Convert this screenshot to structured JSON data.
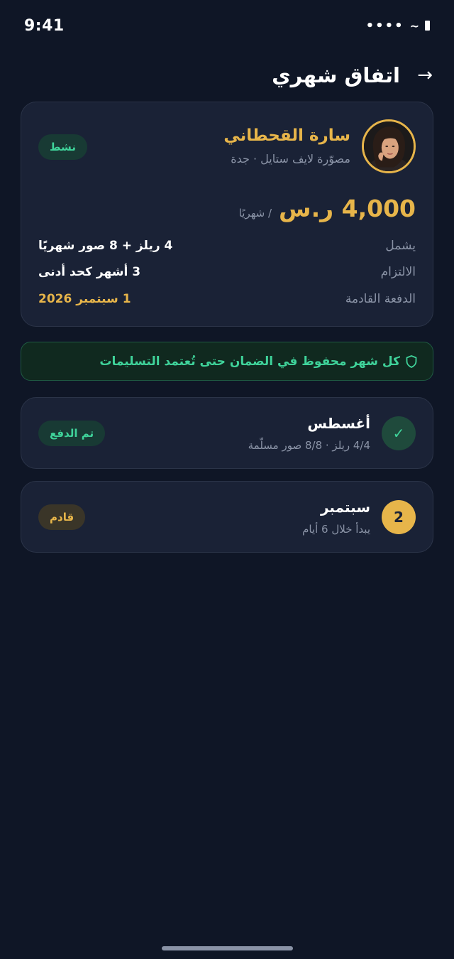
{
  "status_bar": {
    "time": "9:41",
    "signal": "••••",
    "wifi": "~"
  },
  "header": {
    "title": "اتفاق شهري",
    "back_icon": "arrow-right-icon",
    "back_glyph": "→"
  },
  "agreement": {
    "creator_name": "سارة القحطاني",
    "creator_subtitle": "مصوّرة لايف ستايل · جدة",
    "status_badge": "نشط",
    "price": "4,000 ر.س",
    "price_period": "/ شهريًا",
    "details": [
      {
        "label": "يشمل",
        "value": "4 ريلز + 8 صور شهريًا"
      },
      {
        "label": "الالتزام",
        "value": "3 أشهر كحد أدنى"
      },
      {
        "label": "الدفعة القادمة",
        "value": "1 سبتمبر 2026"
      }
    ]
  },
  "escrow": {
    "icon": "shield-icon",
    "text": "كل شهر محفوظ في الضمان حتى تُعتمد التسليمات"
  },
  "months": [
    {
      "name": "أغسطس",
      "subtitle": "4/4 ريلز · 8/8 صور مسلّمة",
      "indicator": "✓",
      "badge": "تم الدفع"
    },
    {
      "name": "سبتمبر",
      "subtitle": "يبدأ خلال 6 أيام",
      "indicator": "2",
      "badge": "قادم"
    }
  ],
  "colors": {
    "background": "#0f1626",
    "card": "#1a2236",
    "gold": "#e7b54a",
    "green": "#3fd39a",
    "muted": "#8a93a6"
  }
}
